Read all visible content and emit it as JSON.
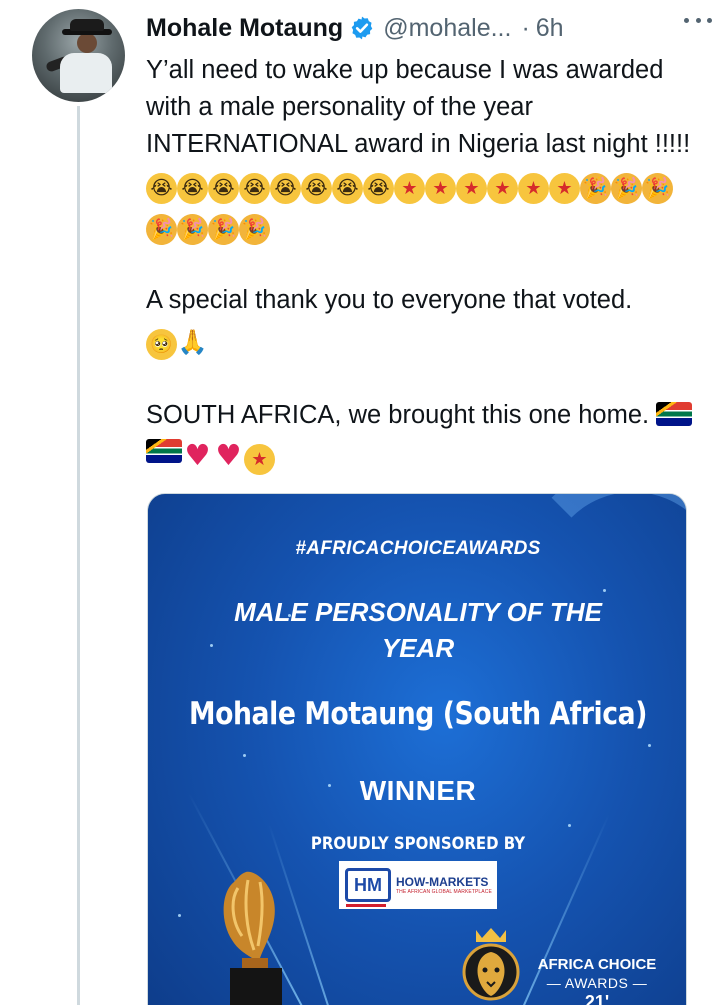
{
  "tweet": {
    "author_name": "Mohale Motaung",
    "handle": "@mohale...",
    "separator": "·",
    "time": "6h",
    "text_line_1": "Y’all need to wake up because I was awarded with a male personality of the year INTERNATIONAL award in Nigeria last night !!!!! ",
    "emojis_line_1": [
      "crying",
      "crying",
      "crying",
      "crying",
      "crying",
      "crying",
      "crying",
      "crying",
      "star-struck",
      "star-struck",
      "star-struck",
      "star-struck",
      "star-struck",
      "star-struck",
      "partying",
      "partying",
      "partying",
      "partying",
      "partying",
      "partying",
      "partying"
    ],
    "text_paragraph_2": "A special thank you to everyone that voted.",
    "emojis_paragraph_2": [
      "pleading-face",
      "folded-hands"
    ],
    "text_paragraph_3": "SOUTH AFRICA, we brought this one home. ",
    "emojis_paragraph_3": [
      "south-africa-flag",
      "south-africa-flag",
      "red-heart",
      "red-heart",
      "star-struck"
    ]
  },
  "glyphs": {
    "crying": "😭",
    "star-struck": "★",
    "partying": "🎉",
    "pleading-face": "🥺",
    "folded-hands": "🙏",
    "red-heart": "♥",
    "south-africa-flag": ""
  },
  "award_card": {
    "hashtag": "#AFRICACHOICEAWARDS",
    "category": "MALE PERSONALITY OF THE YEAR",
    "nominee": "Mohale Motaung (South Africa)",
    "result": "WINNER",
    "sponsor_label": "PROUDLY SPONSORED BY",
    "sponsor_badge": "HM",
    "sponsor_name": "HOW-MARKETS",
    "sponsor_tagline": "THE AFRICAN GLOBAL MARKETPLACE",
    "event_line_1": "AFRICA CHOICE",
    "event_line_2": "— AWARDS —",
    "event_line_3": "21'"
  },
  "colors": {
    "verified_badge": "#1d9bf0",
    "text_primary": "#0f1419",
    "text_secondary": "#536471",
    "card_blue": "#1553b0"
  }
}
